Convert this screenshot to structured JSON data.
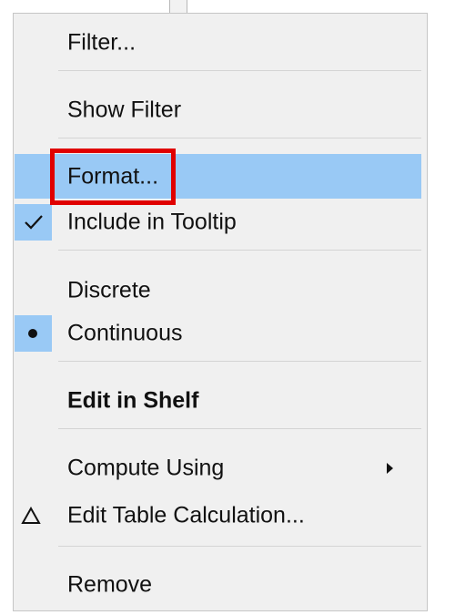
{
  "menu": {
    "items": [
      {
        "label": "Filter..."
      },
      {
        "label": "Show Filter"
      },
      {
        "label": "Format..."
      },
      {
        "label": "Include in Tooltip",
        "checked": true
      },
      {
        "label": "Discrete"
      },
      {
        "label": "Continuous",
        "selected": true
      },
      {
        "label": "Edit in Shelf"
      },
      {
        "label": "Compute Using"
      },
      {
        "label": "Edit Table Calculation..."
      },
      {
        "label": "Remove"
      }
    ]
  },
  "icons": {
    "check": "checkmark-icon",
    "radio": "radio-dot-icon",
    "delta": "delta-icon",
    "submenu": "submenu-arrow-icon"
  },
  "colors": {
    "menu_background": "#f0f0f0",
    "highlight": "#99c9f5",
    "annotation_border": "#e00000",
    "text": "#111111"
  }
}
